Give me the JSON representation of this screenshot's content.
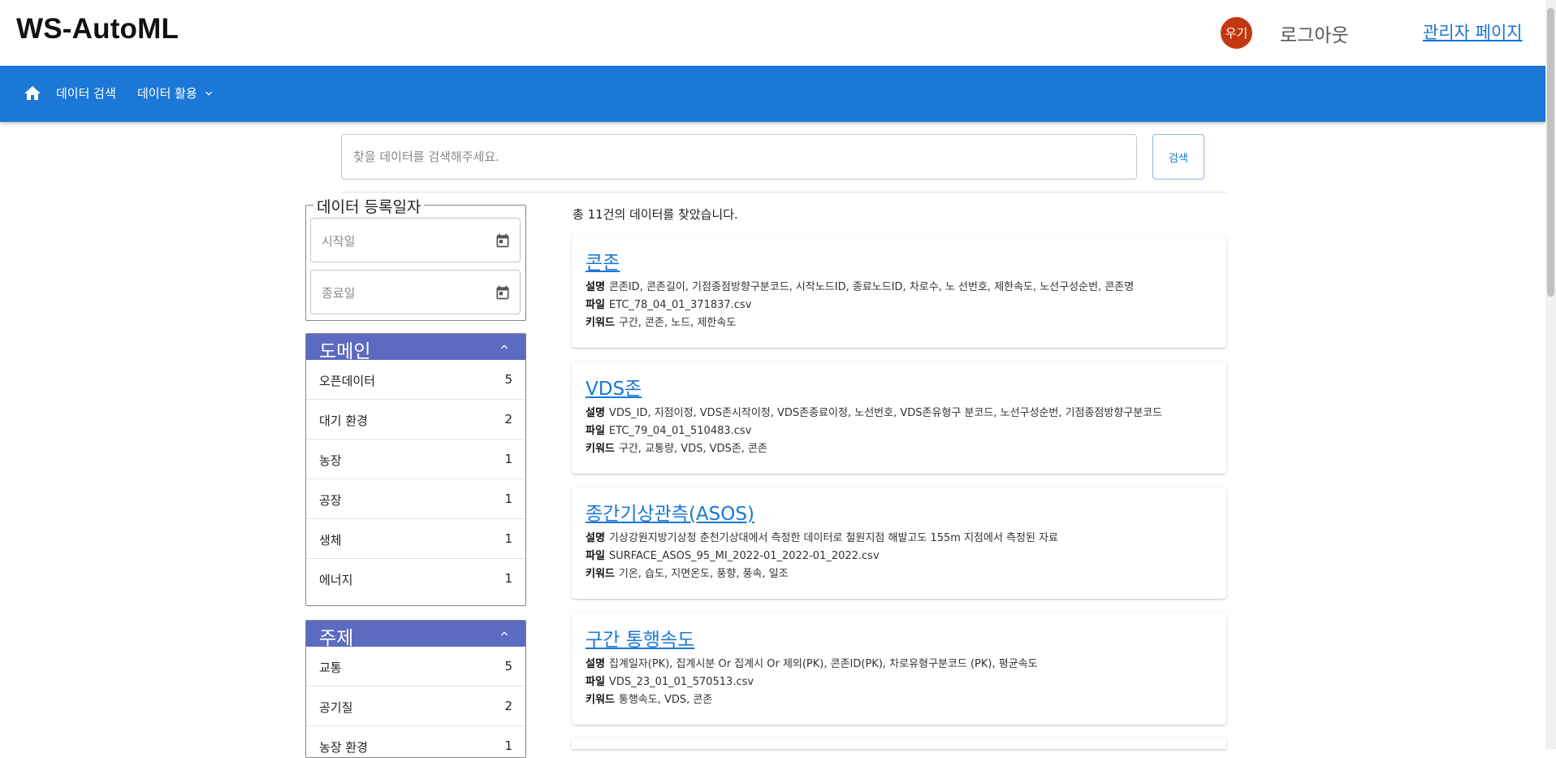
{
  "app": {
    "title": "WS-AutoML"
  },
  "header": {
    "avatar_text": "우기",
    "logout_label": "로그아웃",
    "admin_label": "관리자 페이지"
  },
  "nav": {
    "search_label": "데이터 검색",
    "use_label": "데이터 활용"
  },
  "search": {
    "placeholder": "찾을 데이터를 검색해주세요.",
    "button_label": "검색"
  },
  "date_filter": {
    "legend": "데이터 등록일자",
    "start_placeholder": "시작일",
    "end_placeholder": "종료일"
  },
  "domain_facet": {
    "title": "도메인",
    "items": [
      {
        "label": "오픈데이터",
        "count": "5"
      },
      {
        "label": "대기 환경",
        "count": "2"
      },
      {
        "label": "농장",
        "count": "1"
      },
      {
        "label": "공장",
        "count": "1"
      },
      {
        "label": "생체",
        "count": "1"
      },
      {
        "label": "에너지",
        "count": "1"
      }
    ]
  },
  "topic_facet": {
    "title": "주제",
    "items": [
      {
        "label": "교통",
        "count": "5"
      },
      {
        "label": "공기질",
        "count": "2"
      },
      {
        "label": "농장 환경",
        "count": "1"
      }
    ]
  },
  "results": {
    "summary": "총 11건의 데이터를 찾았습니다.",
    "desc_label": "설명",
    "file_label": "파일",
    "keyword_label": "키워드",
    "items": [
      {
        "title": "콘존",
        "desc": "콘존ID, 콘존길이, 기점종점방향구분코드, 시작노드ID, 종료노드ID, 차로수, 노 선번호, 제한속도, 노선구성순번, 콘존명",
        "file": "ETC_78_04_01_371837.csv",
        "keywords": "구간, 콘존, 노드, 제한속도"
      },
      {
        "title": "VDS존",
        "desc": "VDS_ID, 지점이정, VDS존시작이정, VDS존종료이정, 노선번호, VDS존유형구 분코드, 노선구성순번, 기점종점방향구분코드",
        "file": "ETC_79_04_01_510483.csv",
        "keywords": "구간, 교통량, VDS, VDS존, 콘존"
      },
      {
        "title": "종간기상관측(ASOS)",
        "desc": "기상강원지방기상청 춘천기상대에서 측정한 데이터로 철원지점 해발고도 155m 지점에서 측정된 자료",
        "file": "SURFACE_ASOS_95_MI_2022-01_2022-01_2022.csv",
        "keywords": "기온, 습도, 지면온도, 풍향, 풍속, 일조"
      },
      {
        "title": "구간 통행속도",
        "desc": "집계일자(PK), 집계시분 Or 집계시 Or 제외(PK), 콘존ID(PK), 차로유형구분코드 (PK), 평균속도",
        "file": "VDS_23_01_01_570513.csv",
        "keywords": "통행속도, VDS, 콘존"
      }
    ]
  },
  "colors": {
    "nav_bg": "#1b78d6",
    "facet_header": "#5c6bc0",
    "avatar_bg": "#c3380f",
    "link": "#1b78d6"
  },
  "icons": [
    "home-icon",
    "chevron-down-icon",
    "calendar-icon",
    "chevron-up-icon"
  ]
}
